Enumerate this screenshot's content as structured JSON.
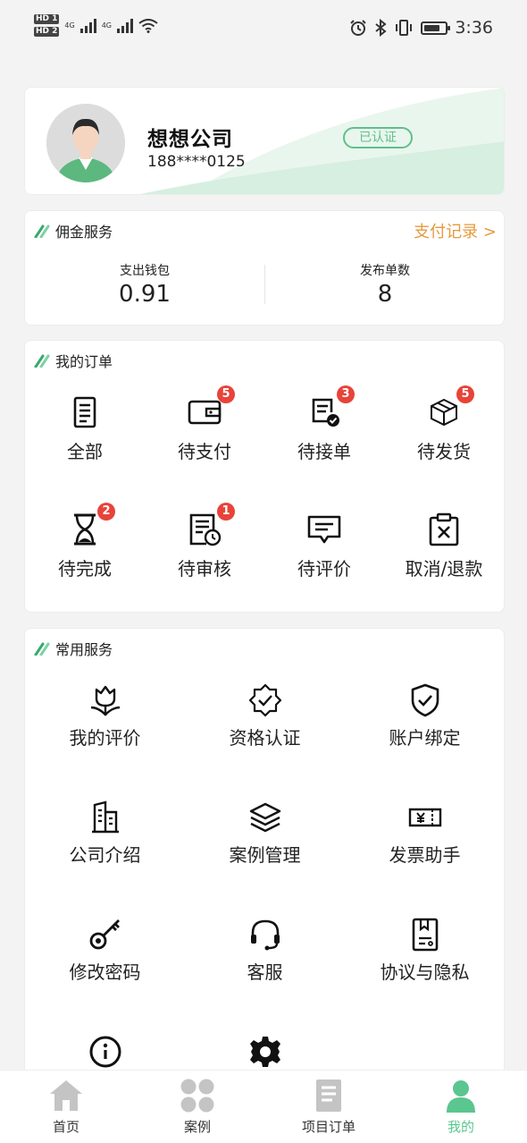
{
  "status_bar": {
    "sim1": "HD 1",
    "sim2": "HD 2",
    "net1": "4G",
    "net2": "4G",
    "time": "3:36"
  },
  "profile": {
    "company_name": "想想公司",
    "phone": "188****0125",
    "verified_label": "已认证"
  },
  "commission": {
    "title": "佣金服务",
    "payment_link": "支付记录 >",
    "wallet_label": "支出钱包",
    "wallet_value": "0.91",
    "orders_label": "发布单数",
    "orders_value": "8"
  },
  "orders": {
    "title": "我的订单",
    "items": [
      {
        "label": "全部",
        "icon": "document-list-icon",
        "badge": ""
      },
      {
        "label": "待支付",
        "icon": "wallet-icon",
        "badge": "5"
      },
      {
        "label": "待接单",
        "icon": "doc-check-icon",
        "badge": "3"
      },
      {
        "label": "待发货",
        "icon": "box-icon",
        "badge": "5"
      },
      {
        "label": "待完成",
        "icon": "hourglass-icon",
        "badge": "2"
      },
      {
        "label": "待审核",
        "icon": "doc-clock-icon",
        "badge": "1"
      },
      {
        "label": "待评价",
        "icon": "comment-icon",
        "badge": ""
      },
      {
        "label": "取消/退款",
        "icon": "clipboard-x-icon",
        "badge": ""
      }
    ]
  },
  "services": {
    "title": "常用服务",
    "items": [
      {
        "label": "我的评价",
        "icon": "tulip-icon"
      },
      {
        "label": "资格认证",
        "icon": "badge-check-icon"
      },
      {
        "label": "账户绑定",
        "icon": "shield-check-icon"
      },
      {
        "label": "公司介绍",
        "icon": "building-icon"
      },
      {
        "label": "案例管理",
        "icon": "layers-icon"
      },
      {
        "label": "发票助手",
        "icon": "invoice-icon"
      },
      {
        "label": "修改密码",
        "icon": "key-icon"
      },
      {
        "label": "客服",
        "icon": "headset-icon"
      },
      {
        "label": "协议与隐私",
        "icon": "agreement-icon"
      },
      {
        "label": "",
        "icon": "info-icon"
      },
      {
        "label": "",
        "icon": "settings-icon"
      }
    ]
  },
  "tabbar": {
    "items": [
      {
        "label": "首页",
        "icon": "home-icon"
      },
      {
        "label": "案例",
        "icon": "grid-icon"
      },
      {
        "label": "项目订单",
        "icon": "order-doc-icon"
      },
      {
        "label": "我的",
        "icon": "user-icon"
      }
    ],
    "active_index": 3
  },
  "colors": {
    "accent_green": "#5bc68f",
    "link_orange": "#e79a3c",
    "badge_red": "#e8433a"
  }
}
